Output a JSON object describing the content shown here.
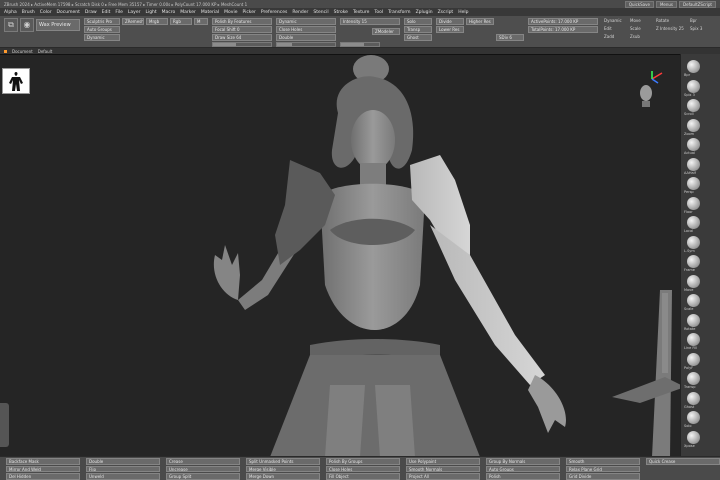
{
  "titlebar": {
    "text": "ZBrush 2024 ▸ ActiveMem 17598 ▸ Scratch Disk 0 ▸ Free Mem 35157 ▸ Timer 0.00s ▸ PolyCount 17.000 KP ▸ MeshCount 1",
    "buttons": [
      "QuickSave",
      "Menus",
      "DefaultZScript"
    ]
  },
  "menubar": {
    "items": [
      "Alpha",
      "Brush",
      "Color",
      "Document",
      "Draw",
      "Edit",
      "File",
      "Layer",
      "Light",
      "Macro",
      "Marker",
      "Material",
      "Movie",
      "Picker",
      "Preferences",
      "Render",
      "Stencil",
      "Stroke",
      "Texture",
      "Tool",
      "Transform",
      "Zplugin",
      "Zscript",
      "Help"
    ]
  },
  "toolshelf": {
    "active_tool_label": "Wax Preview",
    "boxes": [
      "Sculptris Pro",
      "Auto Groups",
      "Dynamic",
      "ZRemesher",
      "Mrgb",
      "Rgb",
      "M",
      "Polish By Features",
      "Focal Shift 0",
      "Draw Size 64",
      "Dynamic",
      "Close Holes",
      "Double",
      "Intensity 15",
      "ZModeler",
      "Solo",
      "Transp",
      "Ghost",
      "Divide",
      "Lower Res",
      "Higher Res",
      "SDiv 6",
      "ActivePoints: 17.000 KP",
      "TotalPoints: 17.000 KP"
    ],
    "labels": [
      "Dynamic",
      "Edit",
      "Move",
      "Scale",
      "Rotate",
      "Zadd",
      "Zsub",
      "Z Intensity 25",
      "Bpr",
      "Spix 3"
    ]
  },
  "docbar": {
    "text": "Document",
    "layer": "Default"
  },
  "right_shelf": {
    "items": [
      "Bpr",
      "Spix 3",
      "Scroll",
      "Zoom",
      "Actual",
      "AAHalf",
      "Persp",
      "Floor",
      "Local",
      "L.Sym",
      "Frame",
      "Move",
      "Scale",
      "Rotate",
      "Line Fill",
      "PolyF",
      "Transp",
      "Ghost",
      "Solo",
      "Xpose"
    ]
  },
  "bottombar": {
    "boxes": [
      "Backface Mask",
      "Mirror And Weld",
      "Del Hidden",
      "Double",
      "Flip",
      "Unweld",
      "Crease",
      "Uncrease",
      "Group Split",
      "Split Unmasked Points",
      "Merge Visible",
      "Merge Down",
      "Polish By Groups",
      "Close Holes",
      "Fill Object",
      "Use Polypaint",
      "Smooth Normals",
      "Project All",
      "Group By Normals",
      "Auto Groups",
      "Polish",
      "Smooth",
      "Relax Plane Grid",
      "Grid Divide",
      "Quick Crease"
    ]
  },
  "colors": {
    "viewport_bg": "#252525",
    "ui_bg": "#4a4a4a",
    "accent": "#ff9a2e",
    "model": "#8a8a8a"
  }
}
